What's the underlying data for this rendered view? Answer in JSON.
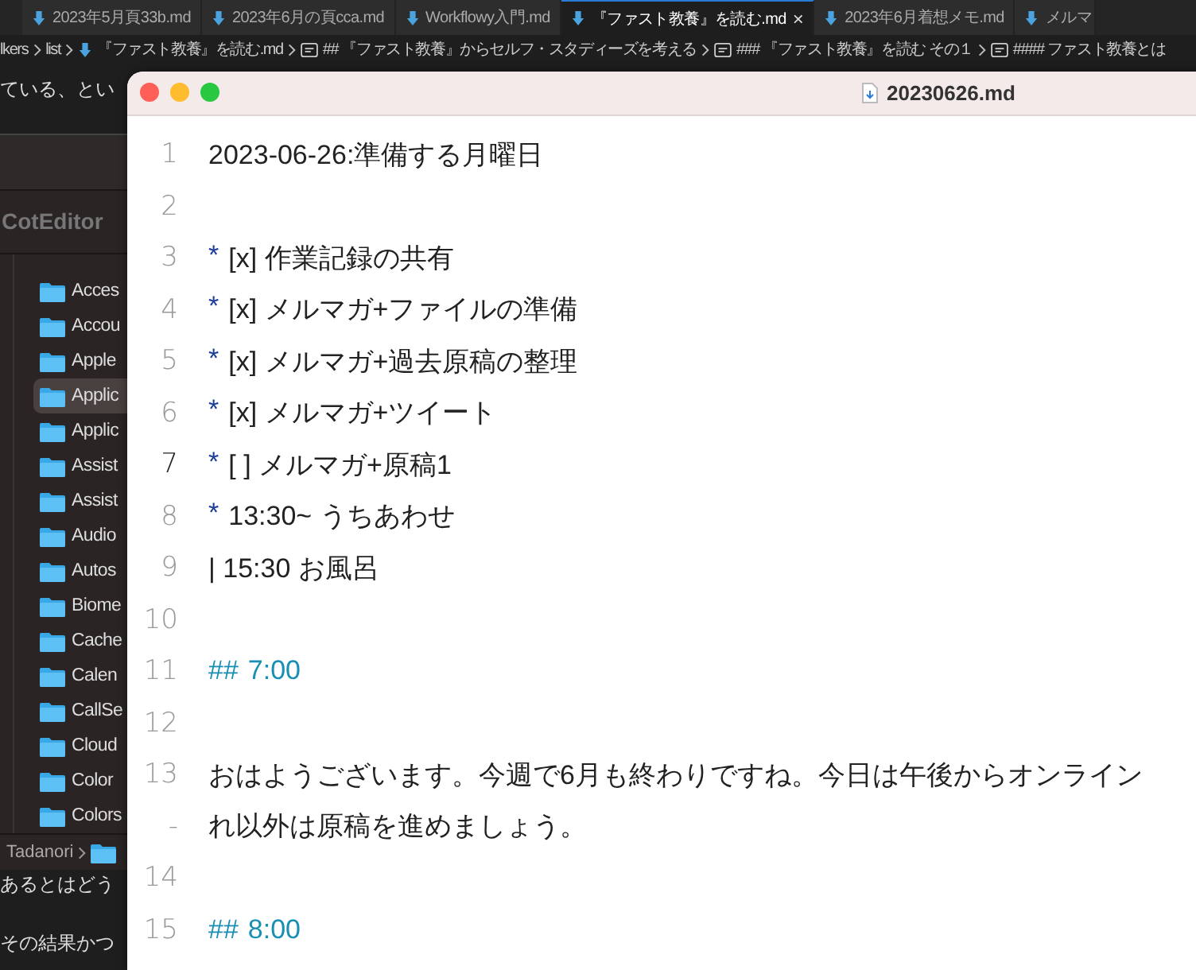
{
  "background_editor": {
    "tabs": [
      {
        "label": "2023年5月頁33b.md",
        "selected": false
      },
      {
        "label": "2023年6月の頁cca.md",
        "selected": false
      },
      {
        "label": "Workflowy入門.md",
        "selected": false
      },
      {
        "label": "『ファスト教養』を読む.md",
        "selected": true,
        "close": "×"
      },
      {
        "label": "2023年6月着想メモ.md",
        "selected": false
      },
      {
        "label": "メルマ",
        "selected": false
      }
    ],
    "breadcrumb": [
      {
        "label": "lkers",
        "kind": "folder"
      },
      {
        "label": "list",
        "kind": "folder"
      },
      {
        "label": "『ファスト教養』を読む.md",
        "kind": "file"
      },
      {
        "label": "## 『ファスト教養』からセルフ・スタディーズを考える",
        "kind": "section"
      },
      {
        "label": "### 『ファスト教養』を読む その１",
        "kind": "section"
      },
      {
        "label": "#### ファスト教養とは",
        "kind": "section"
      }
    ],
    "text_top": [
      "ている、とい"
    ],
    "text_bottom": [
      "あるとはどう",
      "その結果かつ"
    ]
  },
  "finder": {
    "title": "CotEditor",
    "items": [
      {
        "name": "Acces",
        "selected": false
      },
      {
        "name": "Accou",
        "selected": false
      },
      {
        "name": "Apple",
        "selected": false
      },
      {
        "name": "Applic",
        "selected": true
      },
      {
        "name": "Applic",
        "selected": false
      },
      {
        "name": "Assist",
        "selected": false
      },
      {
        "name": "Assist",
        "selected": false
      },
      {
        "name": "Audio",
        "selected": false
      },
      {
        "name": "Autos",
        "selected": false
      },
      {
        "name": "Biome",
        "selected": false
      },
      {
        "name": "Cache",
        "selected": false
      },
      {
        "name": "Calen",
        "selected": false
      },
      {
        "name": "CallSe",
        "selected": false
      },
      {
        "name": "Cloud",
        "selected": false
      },
      {
        "name": "Color",
        "selected": false
      },
      {
        "name": "Colors",
        "selected": false
      }
    ],
    "path": "Tadanori"
  },
  "editor": {
    "title": "20230626.md",
    "lines": [
      {
        "number": "1",
        "kind": "plain",
        "text": "2023-06-26:準備する月曜日",
        "current": false
      },
      {
        "number": "2",
        "kind": "blank",
        "current": false
      },
      {
        "number": "3",
        "kind": "list",
        "marker": "*",
        "text": "[x] 作業記録の共有",
        "current": false
      },
      {
        "number": "4",
        "kind": "list",
        "marker": "*",
        "text": "[x] メルマガ+ファイルの準備",
        "current": false
      },
      {
        "number": "5",
        "kind": "list",
        "marker": "*",
        "text": "[x] メルマガ+過去原稿の整理",
        "current": false
      },
      {
        "number": "6",
        "kind": "list",
        "marker": "*",
        "text": "[x] メルマガ+ツイート",
        "current": false
      },
      {
        "number": "7",
        "kind": "list",
        "marker": "*",
        "text": "[ ] メルマガ+原稿1",
        "current": true
      },
      {
        "number": "8",
        "kind": "list",
        "marker": "*",
        "text": "13:30~ うちあわせ",
        "current": false
      },
      {
        "number": "9",
        "kind": "plain",
        "text": "| 15:30 お風呂",
        "current": false
      },
      {
        "number": "10",
        "kind": "blank",
        "current": false
      },
      {
        "number": "11",
        "kind": "heading",
        "marker": "##",
        "text": "7:00",
        "current": false
      },
      {
        "number": "12",
        "kind": "blank",
        "current": false
      },
      {
        "number": "13",
        "kind": "plain",
        "text": "おはようございます。今週で6月も終わりですね。今日は午後からオンライン",
        "current": false
      },
      {
        "number": "-",
        "kind": "plain",
        "text": "れ以外は原稿を進めましょう。",
        "current": false
      },
      {
        "number": "14",
        "kind": "blank",
        "current": false
      },
      {
        "number": "15",
        "kind": "heading",
        "marker": "##",
        "text": "8:00",
        "current": false
      }
    ]
  }
}
